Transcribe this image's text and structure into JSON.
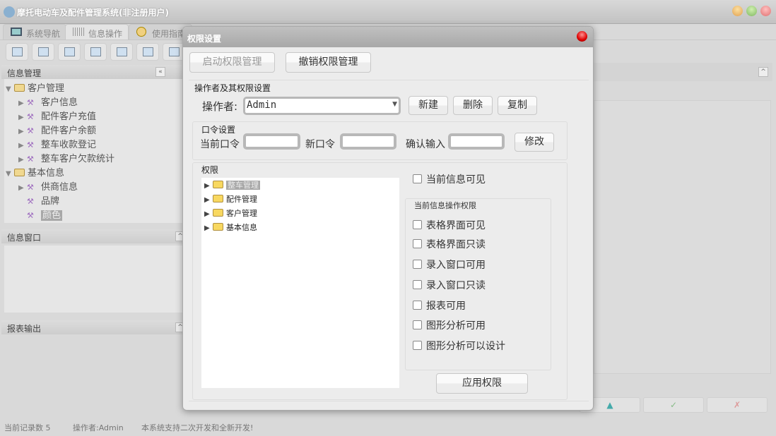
{
  "app": {
    "title": "摩托电动车及配件管理系统(非注册用户)"
  },
  "tabs": [
    {
      "label": "系统导航"
    },
    {
      "label": "信息操作"
    },
    {
      "label": "使用指南"
    }
  ],
  "left": {
    "info_mgmt": "信息管理",
    "tree": [
      {
        "label": "客户管理",
        "type": "folder",
        "expanded": true
      },
      {
        "label": "客户信息",
        "type": "item",
        "arrow": true
      },
      {
        "label": "配件客户充值",
        "type": "item",
        "arrow": true
      },
      {
        "label": "配件客户余额",
        "type": "item",
        "arrow": true
      },
      {
        "label": "整车收款登记",
        "type": "item",
        "arrow": true
      },
      {
        "label": "整车客户欠款统计",
        "type": "item",
        "arrow": true
      },
      {
        "label": "基本信息",
        "type": "folder",
        "expanded": true
      },
      {
        "label": "供商信息",
        "type": "item",
        "arrow": true
      },
      {
        "label": "品牌",
        "type": "item",
        "arrow": false
      },
      {
        "label": "颜色",
        "type": "item",
        "arrow": false,
        "selected": true
      }
    ],
    "info_window": "信息窗口",
    "report_output": "报表输出"
  },
  "status": {
    "records": "当前记录数 5",
    "operator": "操作者:Admin",
    "message": "本系统支持二次开发和全新开发!"
  },
  "bottom_buttons": {
    "up": "▲",
    "ok": "✓",
    "cancel": "✗"
  },
  "dialog": {
    "title": "权限设置",
    "start_btn": "启动权限管理",
    "revoke_btn": "撤销权限管理",
    "operator_group": "操作者及其权限设置",
    "operator_label": "操作者:",
    "operator_value": "Admin",
    "new_btn": "新建",
    "delete_btn": "删除",
    "copy_btn": "复制",
    "pwd_group": "口令设置",
    "current_pwd": "当前口令",
    "new_pwd": "新口令",
    "confirm_pwd": "确认输入",
    "modify_btn": "修改",
    "perm_group": "权限",
    "perm_tree": [
      "整车管理",
      "配件管理",
      "客户管理",
      "基本信息"
    ],
    "visible_cb": "当前信息可见",
    "ops_group": "当前信息操作权限",
    "ops": [
      "表格界面可见",
      "表格界面只读",
      "录入窗口可用",
      "录入窗口只读",
      "报表可用",
      "图形分析可用",
      "图形分析可以设计"
    ],
    "apply_btn": "应用权限"
  }
}
